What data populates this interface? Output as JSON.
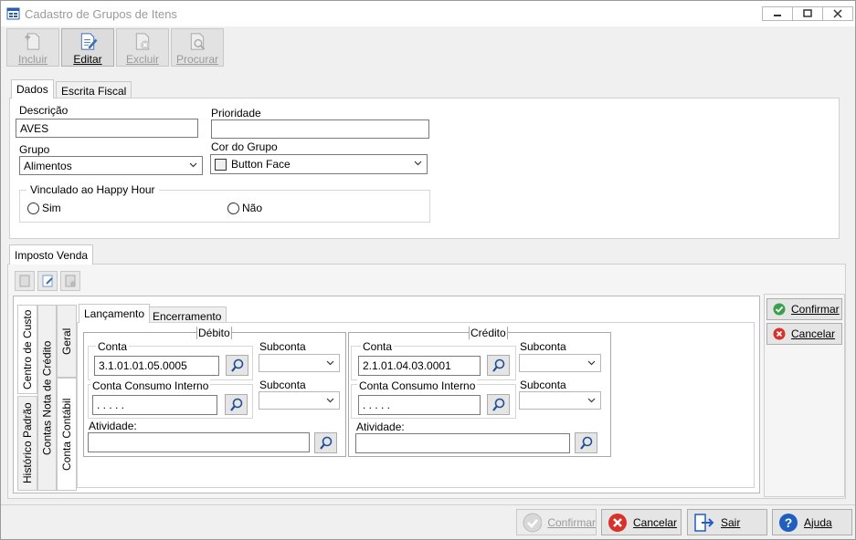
{
  "window": {
    "title": "Cadastro de Grupos de Itens"
  },
  "toolbar": {
    "incluir": "Incluir",
    "editar": "Editar",
    "excluir": "Excluir",
    "procurar": "Procurar"
  },
  "tabs_top": {
    "dados": "Dados",
    "escrita_fiscal": "Escrita Fiscal"
  },
  "form": {
    "descricao_label": "Descrição",
    "descricao_value": "AVES",
    "prioridade_label": "Prioridade",
    "prioridade_value": "",
    "grupo_label": "Grupo",
    "grupo_value": "Alimentos",
    "cor_label": "Cor do Grupo",
    "cor_value": "Button Face",
    "happy_hour_label": "Vinculado ao Happy Hour",
    "sim": "Sim",
    "nao": "Não"
  },
  "imposto": {
    "tab_label": "Imposto Venda"
  },
  "vertical_tabs": {
    "centro_custo": "Centro de Custo",
    "historico_padrao": "Histórico Padrão",
    "contas_nota_credito": "Contas Nota de Crédito",
    "geral": "Geral",
    "conta_contabil": "Conta Contábil"
  },
  "inner_tabs": {
    "lancamento": "Lançamento",
    "encerramento": "Encerramento"
  },
  "debito": {
    "title": "Débito",
    "conta_label": "Conta",
    "conta_value": "3.1.01.01.05.0005",
    "subconta_label": "Subconta",
    "consumo_label": "Conta Consumo Interno",
    "consumo_value": ". . . . .",
    "subconta2_label": "Subconta",
    "atividade_label": "Atividade:",
    "atividade_value": ""
  },
  "credito": {
    "title": "Crédito",
    "conta_label": "Conta",
    "conta_value": "2.1.01.04.03.0001",
    "subconta_label": "Subconta",
    "consumo_label": "Conta Consumo Interno",
    "consumo_value": ". . . . .",
    "subconta2_label": "Subconta",
    "atividade_label": "Atividade:",
    "atividade_value": ""
  },
  "side": {
    "confirmar": "Confirmar",
    "cancelar": "Cancelar"
  },
  "bottom": {
    "confirmar": "Confirmar",
    "cancelar": "Cancelar",
    "sair": "Sair",
    "ajuda": "Ajuda"
  },
  "colors": {
    "accent_green": "#3aa14b",
    "cancel_red": "#d8312b",
    "help_blue": "#1f5fbf",
    "disabled_text": "#9a9a9a"
  }
}
